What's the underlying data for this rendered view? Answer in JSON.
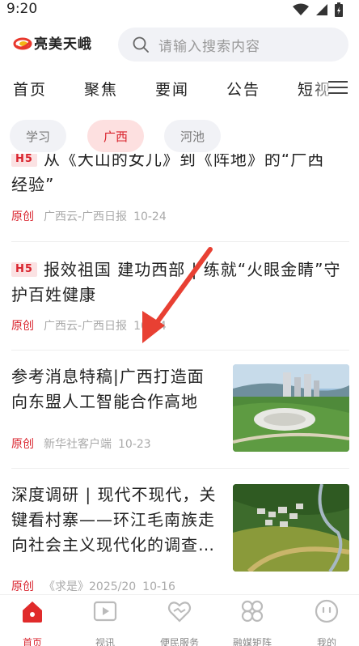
{
  "status": {
    "time": "9:20"
  },
  "header": {
    "logo_text": "亮美天峨",
    "search_placeholder": "请输入搜索内容"
  },
  "channels": [
    "首页",
    "聚焦",
    "要闻",
    "公告",
    "短视"
  ],
  "subtabs": [
    {
      "label": "学习",
      "active": false
    },
    {
      "label": "广西",
      "active": true
    },
    {
      "label": "河池",
      "active": false
    }
  ],
  "articles": [
    {
      "tag": "H5",
      "title_line1": "从《大山的女儿》到《阵地》的“广西",
      "title_line2": "经验”",
      "origin": "原创",
      "source": "广西云-广西日报",
      "date": "10-24"
    },
    {
      "tag": "H5",
      "title": "报效祖国 建功西部 | 练就“火眼金睛”守护百姓健康",
      "origin": "原创",
      "source": "广西云-广西日报",
      "date": "10-24"
    },
    {
      "title": "参考消息特稿|广西打造面向东盟人工智能合作高地",
      "origin": "原创",
      "source": "新华社客户端",
      "date": "10-23"
    },
    {
      "title": "深度调研 | 现代不现代，关键看村寨——环江毛南族走向社会主义现代化的调查…",
      "origin": "原创",
      "source": "《求是》2025/20",
      "date": "10-16"
    }
  ],
  "bottom_nav": [
    {
      "label": "首页",
      "icon": "home-icon",
      "active": true
    },
    {
      "label": "视讯",
      "icon": "video-icon",
      "active": false
    },
    {
      "label": "便民服务",
      "icon": "heart-handshake-icon",
      "active": false
    },
    {
      "label": "融媒矩阵",
      "icon": "grid-icon",
      "active": false
    },
    {
      "label": "我的",
      "icon": "profile-face-icon",
      "active": false
    }
  ],
  "colors": {
    "accent": "#d9232d",
    "tag_bg": "#fbe2e3",
    "search_bg": "#f1f2f6"
  }
}
